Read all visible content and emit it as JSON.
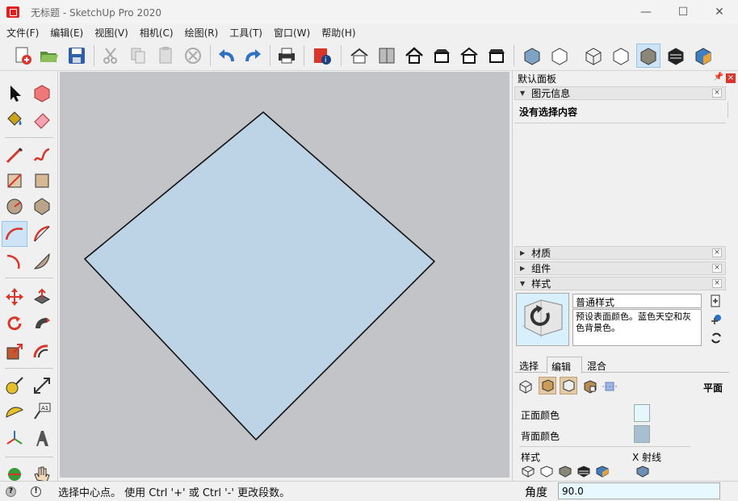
{
  "window": {
    "title": "无标题 - SketchUp Pro 2020",
    "min_glyph": "—",
    "max_glyph": "☐",
    "close_glyph": "✕"
  },
  "menu": [
    "文件(F)",
    "编辑(E)",
    "视图(V)",
    "相机(C)",
    "绘图(R)",
    "工具(T)",
    "窗口(W)",
    "帮助(H)"
  ],
  "tray": {
    "title": "默认面板",
    "entity_info": {
      "title": "图元信息",
      "content": "没有选择内容"
    },
    "materials": {
      "title": "材质"
    },
    "components": {
      "title": "组件"
    },
    "styles": {
      "title": "样式",
      "style_name": "普通样式",
      "description": "预设表面颜色。蓝色天空和灰色背景色。",
      "tabs": [
        "选择",
        "编辑",
        "混合"
      ],
      "active_tab": "编辑",
      "face_label": "平面",
      "front_color_label": "正面颜色",
      "back_color_label": "背面颜色",
      "front_color": "#e6f7fb",
      "back_color": "#a8bfd2",
      "style_label": "样式",
      "xray_label": "X 射线"
    }
  },
  "status": {
    "message": "选择中心点。 使用 Ctrl '+' 或 Ctrl '-' 更改段数。",
    "measure_label": "角度",
    "measure_value": "90.0"
  },
  "canvas": {
    "background": "#c3c4c8",
    "face_color": "#bdd3e6"
  }
}
